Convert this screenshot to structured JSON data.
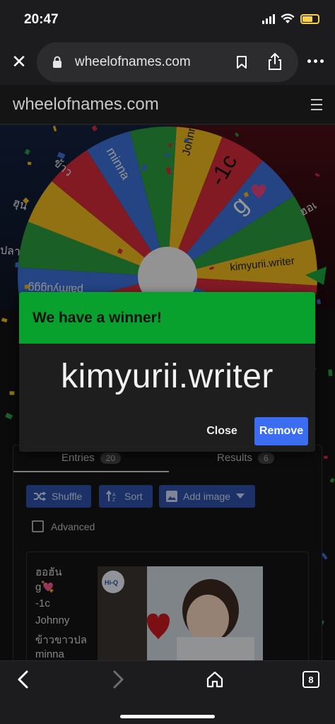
{
  "status_bar": {
    "time": "20:47"
  },
  "browser": {
    "url": "wheelofnames.com",
    "tab_count": "8"
  },
  "site": {
    "brand": "wheelofnames.com"
  },
  "wheel": {
    "labels": {
      "johnny": "Johnny",
      "minna": "minna",
      "neg1c": "-1c",
      "g": "g",
      "kimyurii": "kimyurii.writer",
      "palm": "palmyuggg"
    },
    "outside_labels": {
      "left1": "ข้าว",
      "left2": "ฮุน",
      "left3": "ปลา",
      "right1": "ฮอเ"
    }
  },
  "modal": {
    "title": "We have a winner!",
    "winner": "kimyurii.writer",
    "close_label": "Close",
    "remove_label": "Remove"
  },
  "panel": {
    "tabs": [
      {
        "label": "Entries",
        "count": "20"
      },
      {
        "label": "Results",
        "count": "6"
      }
    ],
    "buttons": {
      "shuffle": "Shuffle",
      "sort": "Sort",
      "add_image": "Add image"
    },
    "advanced_label": "Advanced",
    "entries": [
      "ฮอฮัน",
      "g💘",
      "-1c",
      "Johnny",
      "ข้าวขาวปล",
      "minna"
    ],
    "photo_badge": "Hi-Q"
  },
  "colors": {
    "green": "#08a12d",
    "blue": "#3b6df2",
    "wheel_red": "#d22a3a",
    "wheel_yellow": "#eab71c",
    "wheel_green": "#2a9a3e",
    "wheel_blue": "#3a6fd6"
  }
}
